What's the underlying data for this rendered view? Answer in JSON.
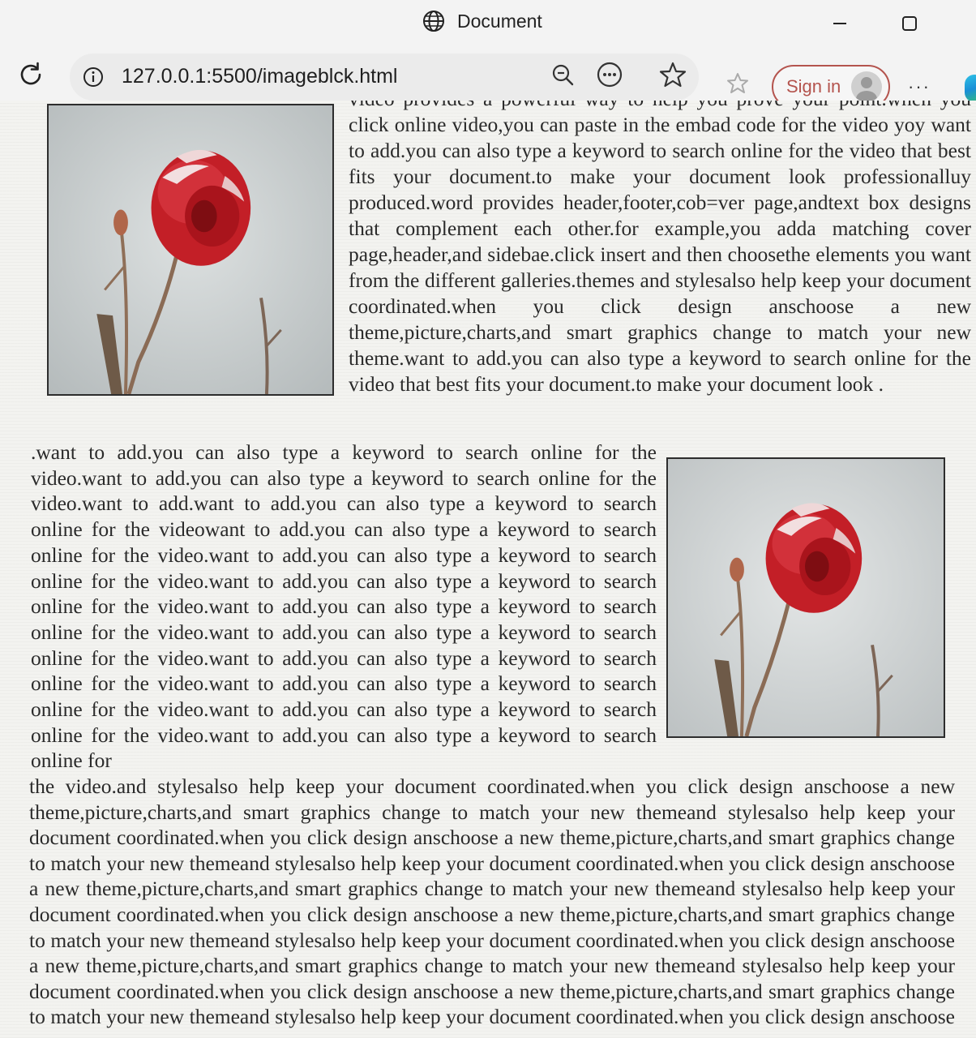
{
  "window": {
    "tab_title": "Document",
    "minimize_icon": "minimize-icon",
    "maximize_icon": "maximize-icon"
  },
  "toolbar": {
    "url": "127.0.0.1:5500/imageblck.html",
    "signin_label": "Sign in",
    "more_label": "···",
    "icons": [
      "reload-icon",
      "info-icon",
      "zoom-out-icon",
      "read-aloud-icon",
      "favorite-star-icon",
      "favorites-collection-icon",
      "profile-avatar-icon",
      "edge-logo-icon"
    ]
  },
  "page": {
    "paragraph1": "video provides a powerful way to help you prove your point.when you click online video,you can paste in the embad code for the video yoy want to add.you can also type a keyword to search online for the video that best fits your document.to make your document look professionalluy produced.word provides header,footer,cob=ver page,andtext box designs that complement each other.for example,you adda matching cover page,header,and sidebae.click insert and then choosethe elements you want from the different galleries.themes and stylesalso help keep your document coordinated.when you click design anschoose a new theme,picture,charts,and smart graphics change to match your new theme.want to add.you can also type a keyword to search online for the video that best fits your document.to make your document look .",
    "paragraph2": ".want to add.you can also type a keyword to search online for the video.want to add.you can also type a keyword to search online for the video.want to add.want to add.you can also type a keyword to search online for the videowant to add.you can also type a keyword to search online for the video.want to add.you can also type a keyword to search online for the video.want to add.you can also type a keyword to search online for the video.want to add.you can also type a keyword to search online for the video.want to add.you can also type a keyword to search online for the video.want to add.you can also type a keyword to search online for the video.want to add.you can also type a keyword to search online for the video.want to add.you can also type a keyword to search online for the video.want to add.you can also type a keyword to search online for",
    "paragraph3": "the video.and stylesalso help keep your document coordinated.when you click design anschoose a new theme,picture,charts,and smart graphics change to match your new themeand stylesalso help keep your document coordinated.when you click design anschoose a new theme,picture,charts,and smart graphics change to match your new themeand stylesalso help keep your document coordinated.when you click design anschoose a new theme,picture,charts,and smart graphics change to match your new themeand stylesalso help keep your document coordinated.when you click design anschoose a new theme,picture,charts,and smart graphics change to match your new themeand stylesalso help keep your document coordinated.when you click design anschoose a new theme,picture,charts,and smart graphics change to match your new themeand stylesalso help keep your document coordinated.when you click design anschoose a new theme,picture,charts,and smart graphics change to match your new themeand stylesalso help keep your document coordinated.when you click design anschoose a new",
    "image_subject": "red-rose-photo"
  },
  "colors": {
    "signin_accent": "#b4544e",
    "text": "#2a2a2a",
    "rose": "#c8232a"
  }
}
